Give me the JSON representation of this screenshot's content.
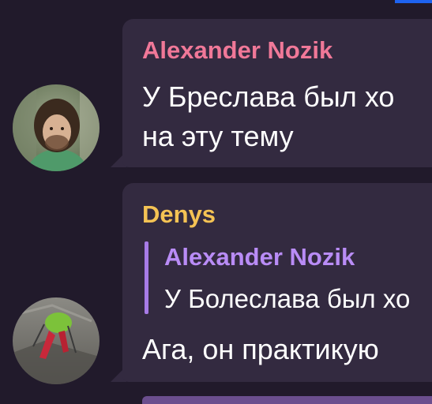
{
  "messages": [
    {
      "sender": "Alexander Nozik",
      "text_line_1": "У Бреслава был хо",
      "text_line_2": "на эту тему"
    },
    {
      "sender": "Denys",
      "reply": {
        "sender": "Alexander Nozik",
        "text": "У Болеслава был хо"
      },
      "text": "Ага, он практикую"
    }
  ],
  "colors": {
    "background": "#211a2b",
    "bubble": "#332a40",
    "sender_1": "#f07898",
    "sender_2": "#f5c354",
    "reply_accent": "#b98cf6"
  }
}
